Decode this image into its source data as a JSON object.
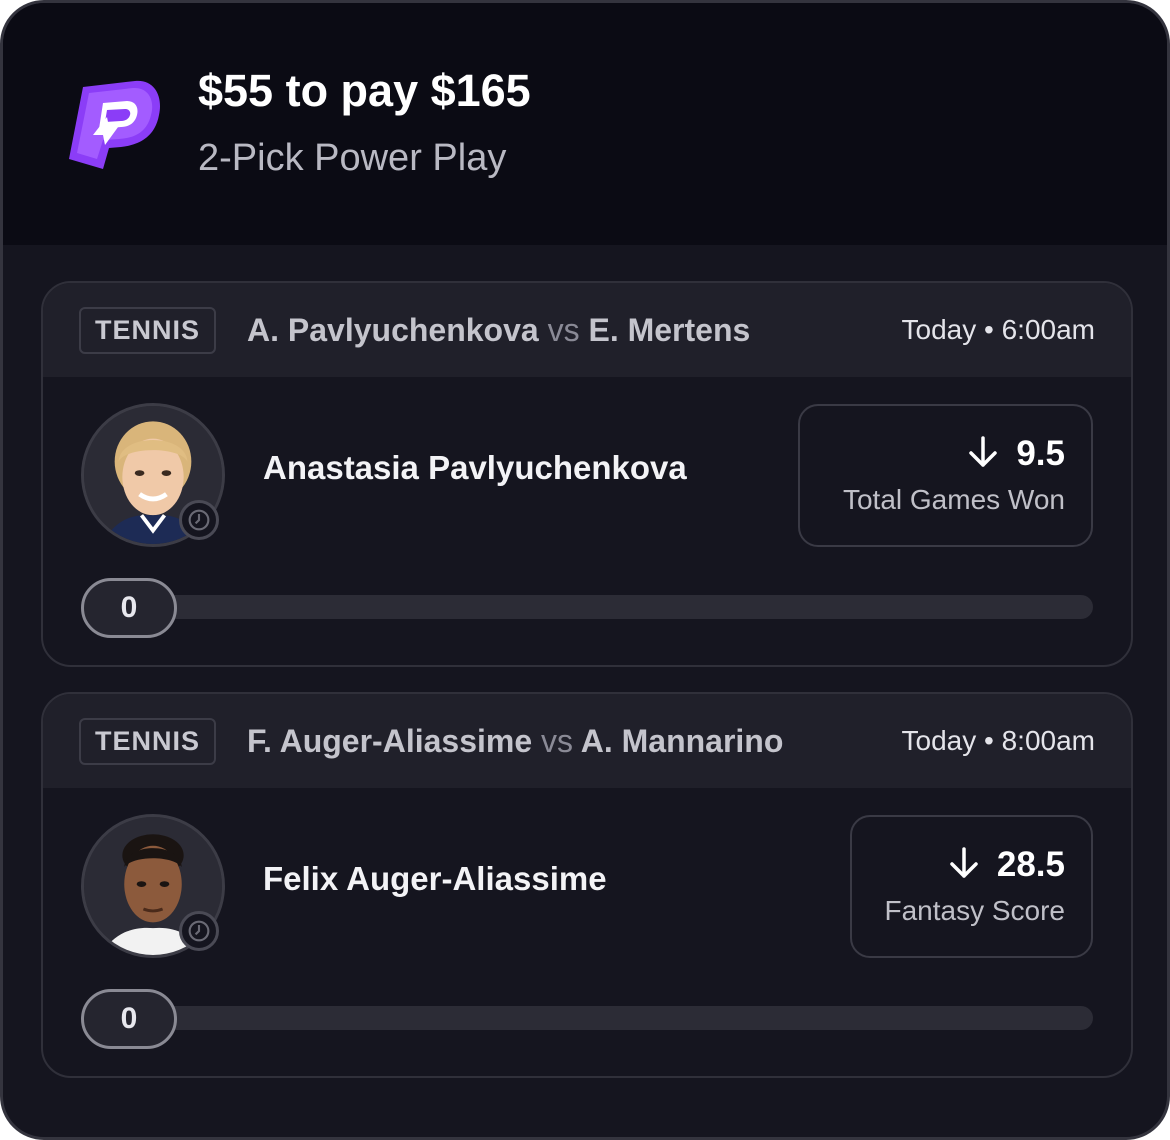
{
  "header": {
    "title": "$55 to pay $165",
    "subtitle": "2-Pick Power Play",
    "logo_icon": "prizepicks-logo-icon",
    "brand_color": "#7b2cf5"
  },
  "picks": [
    {
      "sport": "TENNIS",
      "team_a": "A. Pavlyuchenkova",
      "vs": "vs",
      "team_b": "E. Mertens",
      "time": "Today • 6:00am",
      "player": "Anastasia Pavlyuchenkova",
      "direction_icon": "arrow-down-icon",
      "line": "9.5",
      "stat": "Total Games Won",
      "progress_value": "0",
      "progress_fraction": 0
    },
    {
      "sport": "TENNIS",
      "team_a": "F. Auger-Aliassime",
      "vs": "vs",
      "team_b": "A. Mannarino",
      "time": "Today • 8:00am",
      "player": "Felix Auger-Aliassime",
      "direction_icon": "arrow-down-icon",
      "line": "28.5",
      "stat": "Fantasy Score",
      "progress_value": "0",
      "progress_fraction": 0
    }
  ]
}
